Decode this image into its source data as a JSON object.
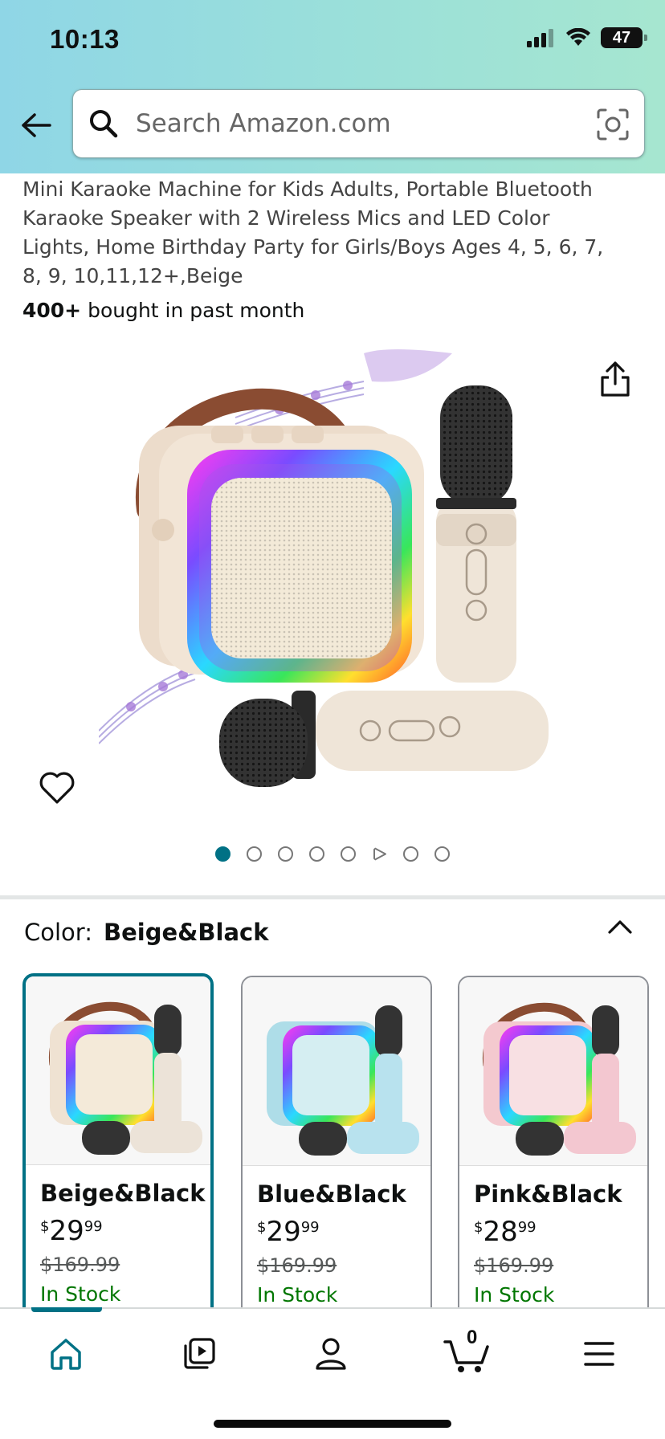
{
  "status_bar": {
    "time": "10:13",
    "battery": "47"
  },
  "search": {
    "placeholder": "Search Amazon.com"
  },
  "product": {
    "title": "Mini Karaoke Machine for Kids Adults, Portable Bluetooth Karaoke Speaker with 2 Wireless Mics and LED Color Lights, Home Birthday Party for Girls/Boys Ages 4, 5, 6, 7, 8, 9, 10,11,12+,Beige",
    "bought_count": "400+",
    "bought_text": " bought in past month",
    "image_count": 8,
    "active_image_index": 0,
    "video_index": 5
  },
  "variations": {
    "label": "Color:",
    "selected": "Beige&Black",
    "options": [
      {
        "name": "Beige&Black",
        "currency": "$",
        "price_whole": "29",
        "price_fraction": "99",
        "was_price": "$169.99",
        "stock": "In Stock",
        "body_color": "#efe2d2",
        "mic_color": "#ece3d8"
      },
      {
        "name": "Blue&Black",
        "currency": "$",
        "price_whole": "29",
        "price_fraction": "99",
        "was_price": "$169.99",
        "stock": "In Stock",
        "body_color": "#aedde8",
        "mic_color": "#b8e2ee"
      },
      {
        "name": "Pink&Black",
        "currency": "$",
        "price_whole": "28",
        "price_fraction": "99",
        "was_price": "$169.99",
        "stock": "In Stock",
        "body_color": "#f4c9cf",
        "mic_color": "#f3c7d0"
      }
    ]
  },
  "bottom_nav": {
    "cart_count": "0",
    "active": "home"
  },
  "colors": {
    "accent": "#007185",
    "in_stock": "#007600"
  }
}
